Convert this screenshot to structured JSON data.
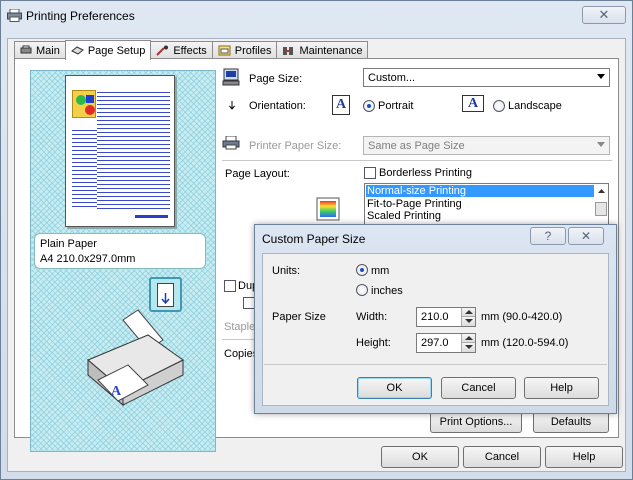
{
  "window": {
    "title": "Printing Preferences",
    "close_glyph": "✕"
  },
  "tabs": [
    {
      "label": "Main",
      "icon": "main-tab-icon"
    },
    {
      "label": "Page Setup",
      "icon": "page-setup-tab-icon",
      "active": true
    },
    {
      "label": "Effects",
      "icon": "effects-tab-icon"
    },
    {
      "label": "Profiles",
      "icon": "profiles-tab-icon"
    },
    {
      "label": "Maintenance",
      "icon": "maintenance-tab-icon"
    }
  ],
  "preview": {
    "media_type": "Plain Paper",
    "paper_dims": "A4 210.0x297.0mm"
  },
  "page_setup": {
    "page_size_label": "Page Size:",
    "page_size_value": "Custom...",
    "orientation_label": "Orientation:",
    "orientation_glyph": "A",
    "portrait_label": "Portrait",
    "landscape_label": "Landscape",
    "portrait_selected": true,
    "printer_paper_size_label": "Printer Paper Size:",
    "printer_paper_size_value": "Same as Page Size",
    "page_layout_label": "Page Layout:",
    "borderless_label": "Borderless Printing",
    "layout_options": [
      "Normal-size Printing",
      "Fit-to-Page Printing",
      "Scaled Printing"
    ],
    "layout_selected_index": 0,
    "duplex_partial": "Dup",
    "staple_partial": "Staple",
    "copies_partial": "Copies",
    "print_options_label": "Print Options...",
    "defaults_label": "Defaults"
  },
  "footer": {
    "ok_label": "OK",
    "cancel_label": "Cancel",
    "help_label": "Help"
  },
  "custom_dialog": {
    "title": "Custom Paper Size",
    "help_glyph": "?",
    "close_glyph": "✕",
    "units_label": "Units:",
    "unit_mm": "mm",
    "unit_inches": "inches",
    "unit_selected": "mm",
    "paper_size_label": "Paper Size",
    "width_label": "Width:",
    "width_value": "210.0",
    "width_range": "mm (90.0-420.0)",
    "height_label": "Height:",
    "height_value": "297.0",
    "height_range": "mm (120.0-594.0)",
    "ok_label": "OK",
    "cancel_label": "Cancel",
    "help_label": "Help"
  },
  "colors": {
    "selection": "#3399ff",
    "preview_bg": "#c9ecf2",
    "window_frame": "#dfe8f2"
  }
}
